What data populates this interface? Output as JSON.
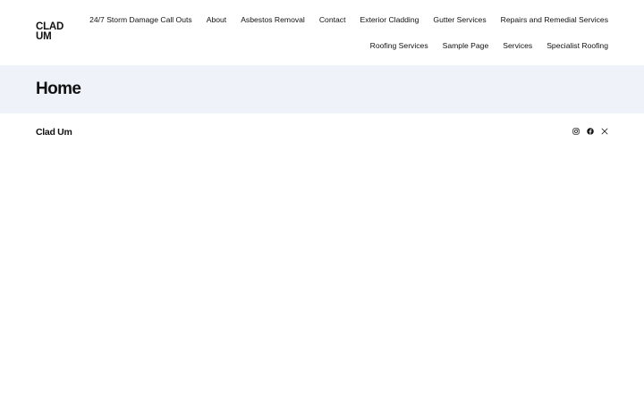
{
  "site": {
    "logo": "CLAD UM"
  },
  "nav": {
    "row1": [
      "24/7 Storm Damage Call Outs",
      "About",
      "Asbestos Removal",
      "Contact",
      "Exterior Cladding",
      "Gutter Services",
      "Repairs and Remedial Services"
    ],
    "row2": [
      "Roofing Services",
      "Sample Page",
      "Services",
      "Specialist Roofing"
    ]
  },
  "hero": {
    "title": "Home"
  },
  "footer": {
    "site_title": "Clad Um",
    "social": [
      "instagram-icon",
      "facebook-icon",
      "x-icon"
    ]
  },
  "colors": {
    "hero_background": "#f0f2f9",
    "text": "#111111"
  }
}
